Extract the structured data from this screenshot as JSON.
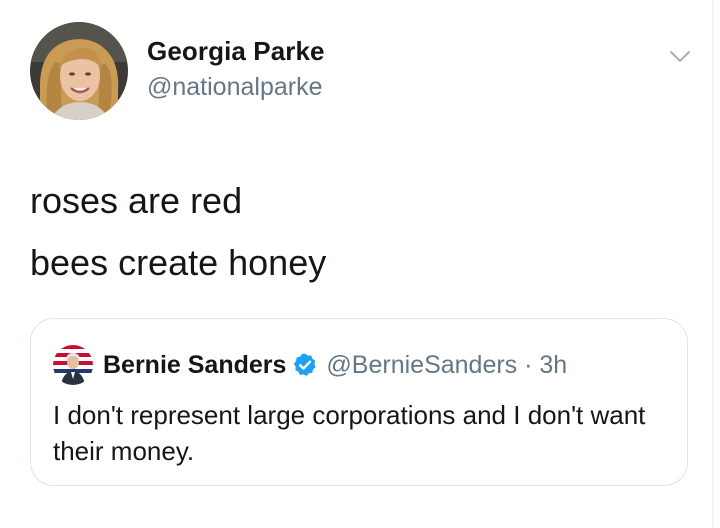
{
  "author": {
    "name": "Georgia Parke",
    "handle": "@nationalparke",
    "avatar_icon": "profile-photo"
  },
  "tweet": {
    "lines": [
      "roses are red",
      "bees create honey"
    ]
  },
  "menu_icon": "chevron-down-icon",
  "quoted_tweet": {
    "name": "Bernie Sanders",
    "verified": true,
    "handle_time": "@BernieSanders · 3h",
    "text": "I don't represent large corporations and I don't want their money.",
    "avatar_icon": "profile-photo"
  },
  "colors": {
    "primary_text": "#14171a",
    "secondary_text": "#657786",
    "verified_blue": "#1da1f2",
    "card_border": "#dfe4ea"
  }
}
